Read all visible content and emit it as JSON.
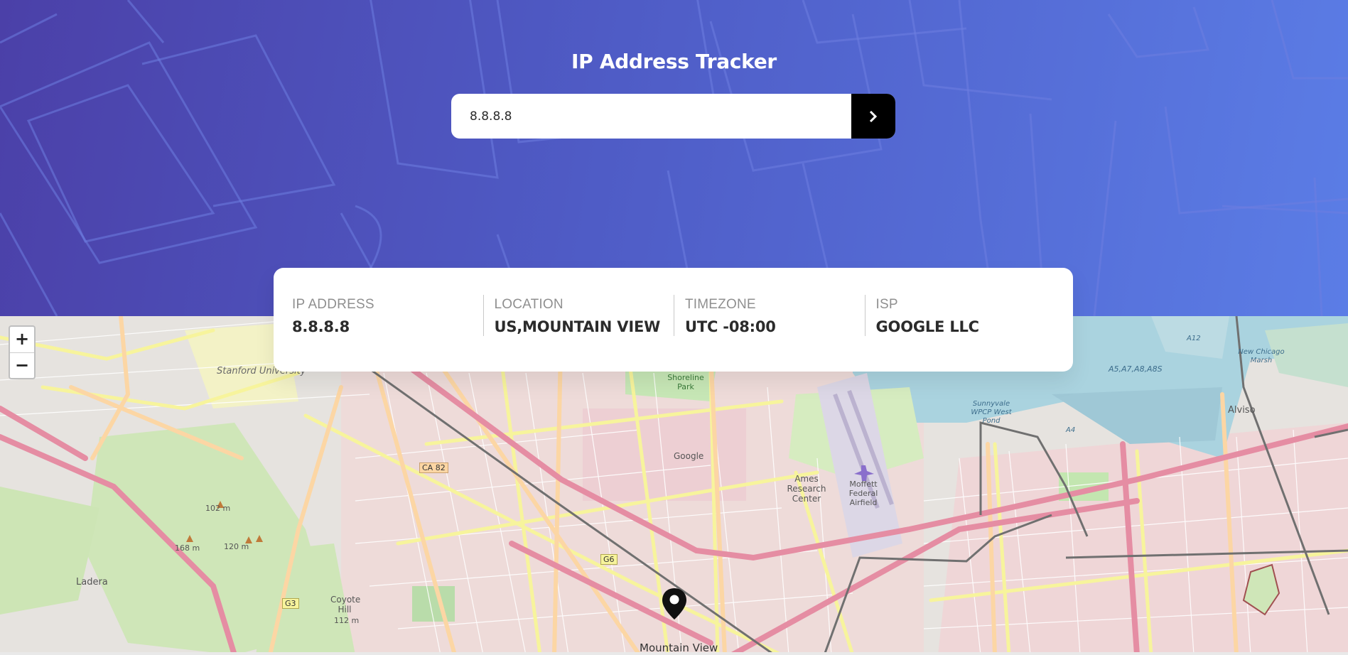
{
  "header": {
    "title": "IP Address Tracker"
  },
  "search": {
    "value": "8.8.8.8",
    "submit_icon": "chevron-right-icon"
  },
  "info": {
    "ip_label": "IP ADDRESS",
    "ip_value": "8.8.8.8",
    "location_label": "LOCATION",
    "location_value": "US,MOUNTAIN VIEW",
    "timezone_label": "TIMEZONE",
    "timezone_value": "UTC -08:00",
    "isp_label": "ISP",
    "isp_value": "GOOGLE LLC"
  },
  "map": {
    "zoom_in": "+",
    "zoom_out": "−",
    "marker_icon": "location-pin-icon",
    "labels": {
      "stanford": "Stanford University",
      "shoreline": "Shoreline Park",
      "google": "Google",
      "ames": "Ames Research Center",
      "moffett": "Moffett Federal Airfield",
      "sunnyvale_wpcp": "Sunnyvale WPCP West Pond",
      "new_chicago": "New Chicago Marsh",
      "alviso": "Alviso",
      "ladera": "Ladera",
      "coyote": "Coyote Hill",
      "coyote_elev": "112 m",
      "mountain_view": "Mountain View",
      "elev_102": "102 m",
      "elev_168": "168 m",
      "elev_120": "120 m",
      "ca82": "CA 82",
      "g6": "G6",
      "g3": "G3",
      "a12": "A12",
      "a5": "A5,A7,A8,A8S",
      "a4": "A4"
    }
  },
  "colors": {
    "header_start": "#4b40a8",
    "header_end": "#5b7de6",
    "button": "#000000",
    "card_value": "#2b2b2b",
    "card_label": "#8f8f8f"
  }
}
